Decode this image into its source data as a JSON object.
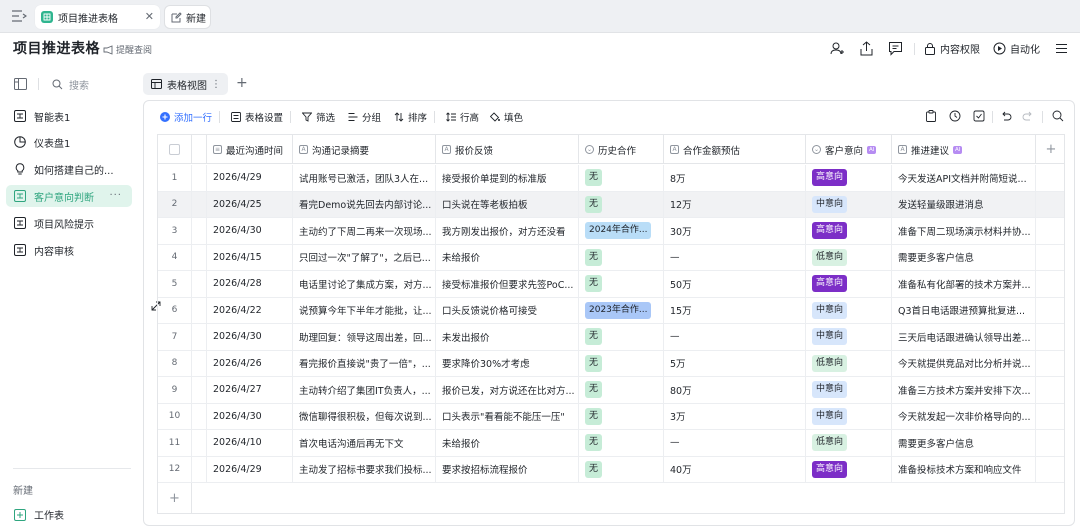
{
  "tabs": [
    {
      "label": "项目推进表格",
      "active": true
    },
    {
      "label": "新建",
      "active": false
    }
  ],
  "header": {
    "title": "项目推进表格",
    "remind": "提醒查阅",
    "permission": "内容权限",
    "automation": "自动化"
  },
  "sidebar": {
    "search": "搜索",
    "items": [
      {
        "label": "智能表1",
        "icon": "sheet-icon"
      },
      {
        "label": "仪表盘1",
        "icon": "pie-chart-icon"
      },
      {
        "label": "如何搭建自己的...",
        "icon": "lightbulb-icon"
      },
      {
        "label": "客户意向判断",
        "icon": "sheet-icon",
        "active": true
      },
      {
        "label": "项目风险提示",
        "icon": "sheet-icon"
      },
      {
        "label": "内容审核",
        "icon": "sheet-icon"
      }
    ],
    "new_label": "新建",
    "worksheet_label": "工作表"
  },
  "view": {
    "tab_label": "表格视图"
  },
  "toolbar": {
    "add_row": "添加一行",
    "table_settings": "表格设置",
    "filter": "筛选",
    "group": "分组",
    "sort": "排序",
    "row_height": "行高",
    "fill_color": "填色"
  },
  "columns": [
    {
      "label": "最近沟通时间",
      "icon": "calendar-icon"
    },
    {
      "label": "沟通记录摘要",
      "icon": "text-icon"
    },
    {
      "label": "报价反馈",
      "icon": "text-icon"
    },
    {
      "label": "历史合作",
      "icon": "select-icon"
    },
    {
      "label": "合作金额预估",
      "icon": "text-icon"
    },
    {
      "label": "客户意向",
      "icon": "select-icon",
      "ai": "AI"
    },
    {
      "label": "推进建议",
      "icon": "text-icon",
      "ai": "AI"
    }
  ],
  "rows": [
    {
      "n": "1",
      "date": "2026/4/29",
      "summary": "试用账号已激活，团队3人在...",
      "quote": "接受报价单提到的标准版",
      "history": "无",
      "history_type": "none",
      "amount": "8万",
      "intent": "高意向",
      "intent_type": "high",
      "advice": "今天发送API文档并附简短说..."
    },
    {
      "n": "2",
      "date": "2026/4/25",
      "summary": "看完Demo说先回去内部讨论...",
      "quote": "口头说在等老板拍板",
      "history": "无",
      "history_type": "none",
      "amount": "12万",
      "intent": "中意向",
      "intent_type": "mid",
      "advice": "发送轻量级跟进消息"
    },
    {
      "n": "3",
      "date": "2026/4/30",
      "summary": "主动约了下周二再来一次现场...",
      "quote": "我方刚发出报价，对方还没看",
      "history": "2024年合作...",
      "history_type": "y24",
      "amount": "30万",
      "intent": "高意向",
      "intent_type": "high",
      "advice": "准备下周二现场演示材料并协..."
    },
    {
      "n": "4",
      "date": "2026/4/15",
      "summary": "只回过一次\"了解了\"，之后已...",
      "quote": "未给报价",
      "history": "无",
      "history_type": "none",
      "amount": "—",
      "intent": "低意向",
      "intent_type": "low",
      "advice": "需要更多客户信息"
    },
    {
      "n": "5",
      "date": "2026/4/28",
      "summary": "电话里讨论了集成方案，对方...",
      "quote": "接受标准报价但要求先签PoC...",
      "history": "无",
      "history_type": "none",
      "amount": "50万",
      "intent": "高意向",
      "intent_type": "high",
      "advice": "准备私有化部署的技术方案并..."
    },
    {
      "n": "6",
      "date": "2026/4/22",
      "summary": "说预算今年下半年才能批，让...",
      "quote": "口头反馈说价格可接受",
      "history": "2023年合作...",
      "history_type": "y23",
      "amount": "15万",
      "intent": "中意向",
      "intent_type": "mid",
      "advice": "Q3首日电话跟进预算批复进..."
    },
    {
      "n": "7",
      "date": "2026/4/30",
      "summary": "助理回复：领导这周出差，回...",
      "quote": "未发出报价",
      "history": "无",
      "history_type": "none",
      "amount": "—",
      "intent": "中意向",
      "intent_type": "mid",
      "advice": "三天后电话跟进确认领导出差..."
    },
    {
      "n": "8",
      "date": "2026/4/26",
      "summary": "看完报价直接说\"贵了一倍\"，...",
      "quote": "要求降价30%才考虑",
      "history": "无",
      "history_type": "none",
      "amount": "5万",
      "intent": "低意向",
      "intent_type": "low",
      "advice": "今天就提供竞品对比分析并说..."
    },
    {
      "n": "9",
      "date": "2026/4/27",
      "summary": "主动转介绍了集团IT负责人，...",
      "quote": "报价已发，对方说还在比对方...",
      "history": "无",
      "history_type": "none",
      "amount": "80万",
      "intent": "中意向",
      "intent_type": "mid",
      "advice": "准备三方技术方案并安排下次..."
    },
    {
      "n": "10",
      "date": "2026/4/30",
      "summary": "微信聊得很积极，但每次说到...",
      "quote": "口头表示\"看看能不能压一压\"",
      "history": "无",
      "history_type": "none",
      "amount": "3万",
      "intent": "中意向",
      "intent_type": "mid",
      "advice": "今天就发起一次非价格导向的..."
    },
    {
      "n": "11",
      "date": "2026/4/10",
      "summary": "首次电话沟通后再无下文",
      "quote": "未给报价",
      "history": "无",
      "history_type": "none",
      "amount": "—",
      "intent": "低意向",
      "intent_type": "low",
      "advice": "需要更多客户信息"
    },
    {
      "n": "12",
      "date": "2026/4/29",
      "summary": "主动发了招标书要求我们投标...",
      "quote": "要求按招标流程报价",
      "history": "无",
      "history_type": "none",
      "amount": "40万",
      "intent": "高意向",
      "intent_type": "high",
      "advice": "准备投标技术方案和响应文件"
    }
  ]
}
